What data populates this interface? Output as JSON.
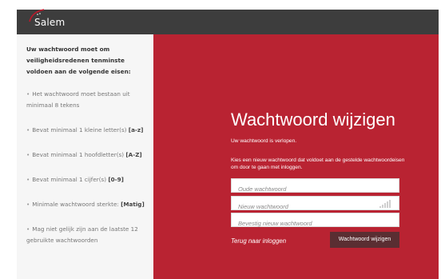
{
  "header": {
    "logo_text": "Salem",
    "background": "#3d3d3d"
  },
  "sidebar": {
    "heading": "Uw wachtwoord moet om veiligheidsredenen tenminste voldoen aan de volgende eisen:",
    "rules": [
      {
        "text": "Het wachtwoord moet bestaan uit minimaal 8 tekens",
        "emphasis": ""
      },
      {
        "text": "Bevat minimaal 1 kleine letter(s) ",
        "emphasis": "[a-z]"
      },
      {
        "text": "Bevat minimaal 1 hoofdletter(s) ",
        "emphasis": "[A-Z]"
      },
      {
        "text": "Bevat minimaal 1 cijfer(s) ",
        "emphasis": "[0-9]"
      },
      {
        "text": "Minimale wachtwoord sterkte: ",
        "emphasis": "[Matig]"
      },
      {
        "text": "Mag niet gelijk zijn aan de laatste 12 gebruikte wachtwoorden",
        "emphasis": ""
      }
    ]
  },
  "form": {
    "title": "Wachtwoord wijzigen",
    "expired_message": "Uw wachtwoord is verlopen.",
    "instructions": "Kies een nieuw wachtwoord dat voldoet aan de gestelde wachtwoordeisen om door te gaan met inloggen.",
    "old_password": {
      "placeholder": "Oude wachtwoord",
      "value": ""
    },
    "new_password": {
      "placeholder": "Nieuw wachtwoord",
      "value": ""
    },
    "confirm_password": {
      "placeholder": "Bevestig nieuw wachtwoord",
      "value": ""
    },
    "back_link": "Terug naar inloggen",
    "submit_label": "Wachtwoord wijzigen",
    "accent_color": "#b92332",
    "button_color": "#5a2e32"
  }
}
